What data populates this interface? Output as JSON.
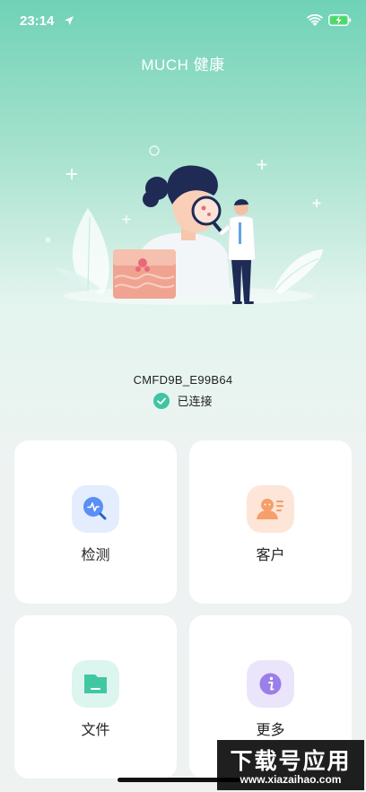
{
  "status_bar": {
    "time": "23:14"
  },
  "app_title": "MUCH 健康",
  "device": {
    "name": "CMFD9B_E99B64",
    "status": "已连接"
  },
  "cards": [
    {
      "label": "检测",
      "icon": "detection-icon",
      "color": "#5b8ff6"
    },
    {
      "label": "客户",
      "icon": "customer-icon",
      "color": "#f59f6b"
    },
    {
      "label": "文件",
      "icon": "file-icon",
      "color": "#42c7a3"
    },
    {
      "label": "更多",
      "icon": "more-info-icon",
      "color": "#9a7ee9"
    }
  ],
  "watermark": {
    "title": "下载号应用",
    "url": "www.xiazaihao.com"
  }
}
